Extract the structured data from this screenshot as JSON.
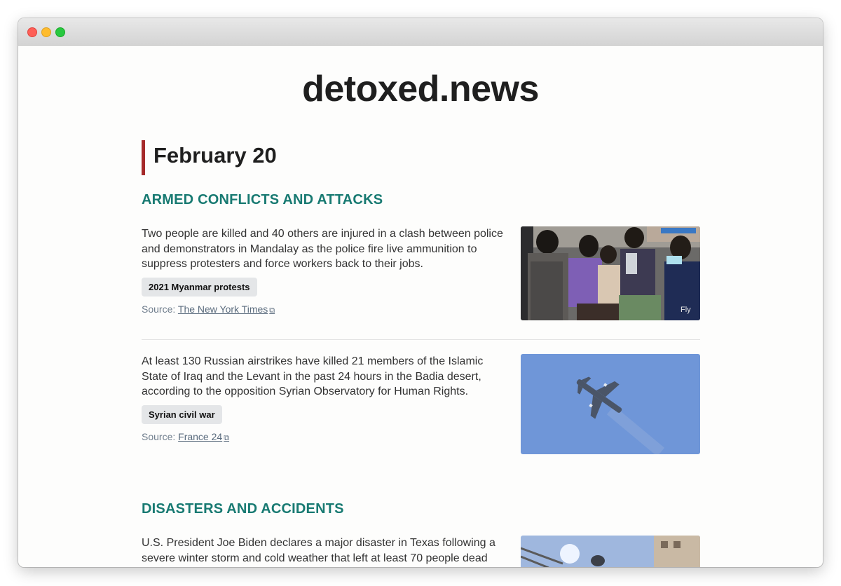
{
  "site": {
    "title": "detoxed.news"
  },
  "date": "February 20",
  "sections": [
    {
      "heading": "ARMED CONFLICTS AND ATTACKS",
      "stories": [
        {
          "text": "Two people are killed and 40 others are injured in a clash between police and demonstrators in Mandalay as the police fire live ammunition to suppress protesters and force workers back to their jobs.",
          "tag": "2021 Myanmar protests",
          "source_prefix": "Source: ",
          "source": "The New York Times",
          "image": "protest-crowd-photo"
        },
        {
          "text": "At least 130 Russian airstrikes have killed 21 members of the Islamic State of Iraq and the Levant in the past 24 hours in the Badia desert, according to the opposition Syrian Observatory for Human Rights.",
          "tag": "Syrian civil war",
          "source_prefix": "Source: ",
          "source": "France 24",
          "image": "fighter-jet-photo"
        }
      ]
    },
    {
      "heading": "DISASTERS AND ACCIDENTS",
      "stories": [
        {
          "text": "U.S. President Joe Biden declares a major disaster in Texas following a severe winter storm and cold weather that left at least 70 people dead and millions of others without power. The declaration allows federal"
        }
      ]
    }
  ],
  "colors": {
    "accent": "#a52a2a",
    "category": "#187a72"
  },
  "icons": {
    "external_link": "external-link-icon"
  }
}
